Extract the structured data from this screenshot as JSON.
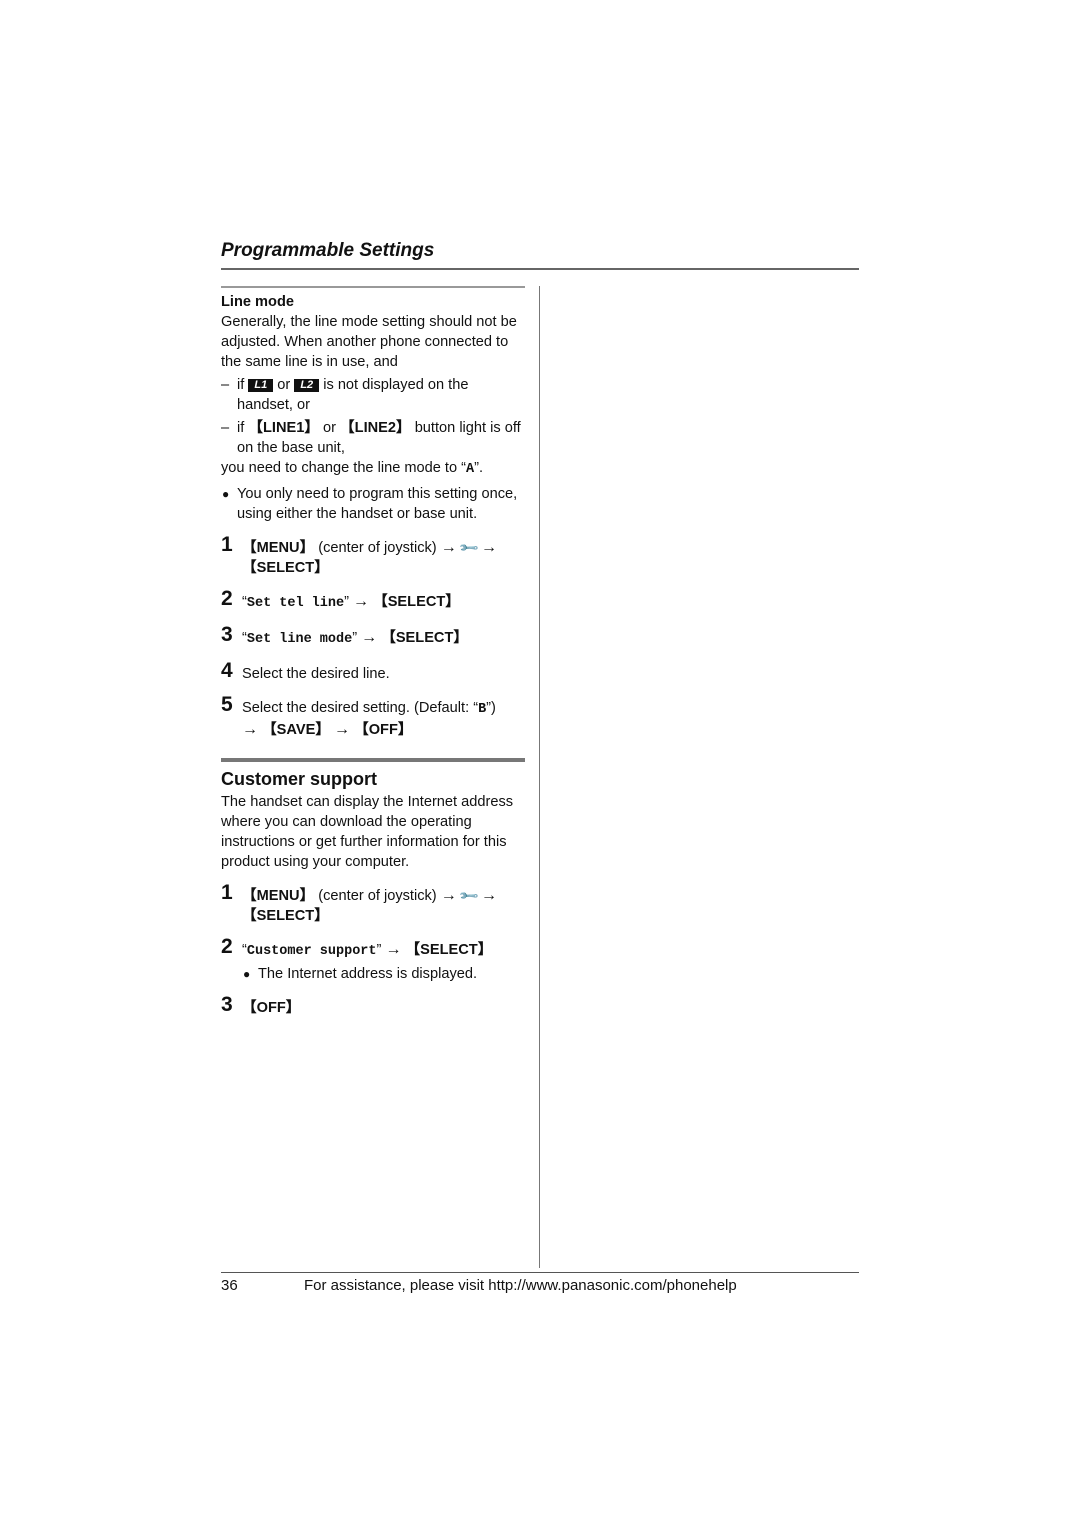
{
  "header": {
    "title": "Programmable Settings"
  },
  "line_mode": {
    "subhead": "Line mode",
    "intro": "Generally, the line mode setting should not be adjusted. When another phone connected to the same line is in use, and",
    "cond1": {
      "dash": "–",
      "pre": "if",
      "badge1": "L1",
      "mid": "or",
      "badge2": "L2",
      "post": "is not displayed on the handset, or"
    },
    "cond2": {
      "dash": "–",
      "pre": "if",
      "key1": "LINE1",
      "mid": "or",
      "key2": "LINE2",
      "post": "button light is off on the base unit,"
    },
    "outro_pre": "you need to change the line mode to “",
    "outro_value": "A",
    "outro_post": "”.",
    "note_bullet": "●",
    "note": "You only need to program this setting once, using either the handset or base unit.",
    "steps": [
      {
        "num": "1",
        "key": "MENU",
        "text": "(center of joystick)",
        "arrow": "→",
        "icon": "wrench-icon",
        "key2": "SELECT"
      },
      {
        "num": "2",
        "open_quote": "“",
        "menu_item": "Set tel line",
        "close_quote": "”",
        "arrow": "→",
        "key": "SELECT"
      },
      {
        "num": "3",
        "open_quote": "“",
        "menu_item": "Set line mode",
        "close_quote": "”",
        "arrow": "→",
        "key": "SELECT"
      },
      {
        "num": "4",
        "text": "Select the desired line."
      },
      {
        "num": "5",
        "text_pre": "Select the desired setting. (Default: “",
        "default": "B",
        "text_post": "”)",
        "arrow": "→",
        "key": "SAVE",
        "key2": "OFF"
      }
    ]
  },
  "customer_support": {
    "heading": "Customer support",
    "intro": "The handset can display the Internet address where you can download the operating instructions or get further information for this product using your computer.",
    "steps": [
      {
        "num": "1",
        "key": "MENU",
        "text": "(center of joystick)",
        "arrow": "→",
        "icon": "wrench-icon",
        "key2": "SELECT"
      },
      {
        "num": "2",
        "open_quote": "“",
        "menu_item": "Customer support",
        "close_quote": "”",
        "arrow": "→",
        "key": "SELECT",
        "bullet": "●",
        "note": "The Internet address is displayed."
      },
      {
        "num": "3",
        "key": "OFF"
      }
    ]
  },
  "brackets": {
    "open": "【",
    "close": "】"
  },
  "footer": {
    "page_number": "36",
    "text": "For assistance, please visit http://www.panasonic.com/phonehelp"
  }
}
